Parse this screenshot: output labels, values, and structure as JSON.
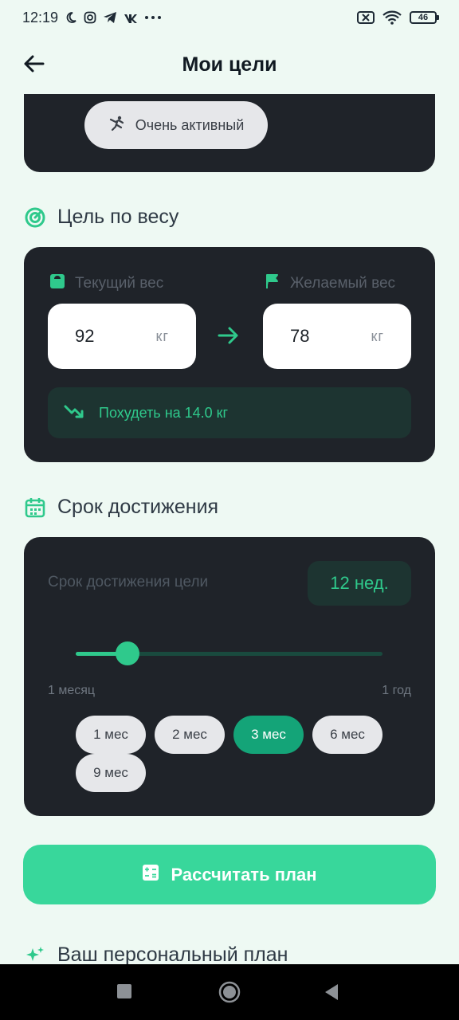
{
  "status": {
    "time": "12:19",
    "battery": "46"
  },
  "header": {
    "title": "Мои цели"
  },
  "activity": {
    "selected_label": "Очень активный"
  },
  "weight_section": {
    "title": "Цель по весу",
    "current_label": "Текущий вес",
    "target_label": "Желаемый вес",
    "current_value": "92",
    "target_value": "78",
    "unit": "кг",
    "result_text": "Похудеть на 14.0 кг"
  },
  "deadline_section": {
    "title": "Срок достижения",
    "label": "Срок достижения цели",
    "badge": "12 нед.",
    "slider_value_fraction": 0.17,
    "range_min": "1 месяц",
    "range_max": "1 год",
    "chips": [
      "1 мес",
      "2 мес",
      "3 мес",
      "6 мес",
      "9 мес"
    ],
    "selected_chip": "3 мес"
  },
  "actions": {
    "calculate_label": "Рассчитать план"
  },
  "plan_section": {
    "title": "Ваш персональный план"
  },
  "colors": {
    "accent": "#2fc98c",
    "button": "#38d79b",
    "card": "#1f2329",
    "background": "#eef9f3"
  }
}
